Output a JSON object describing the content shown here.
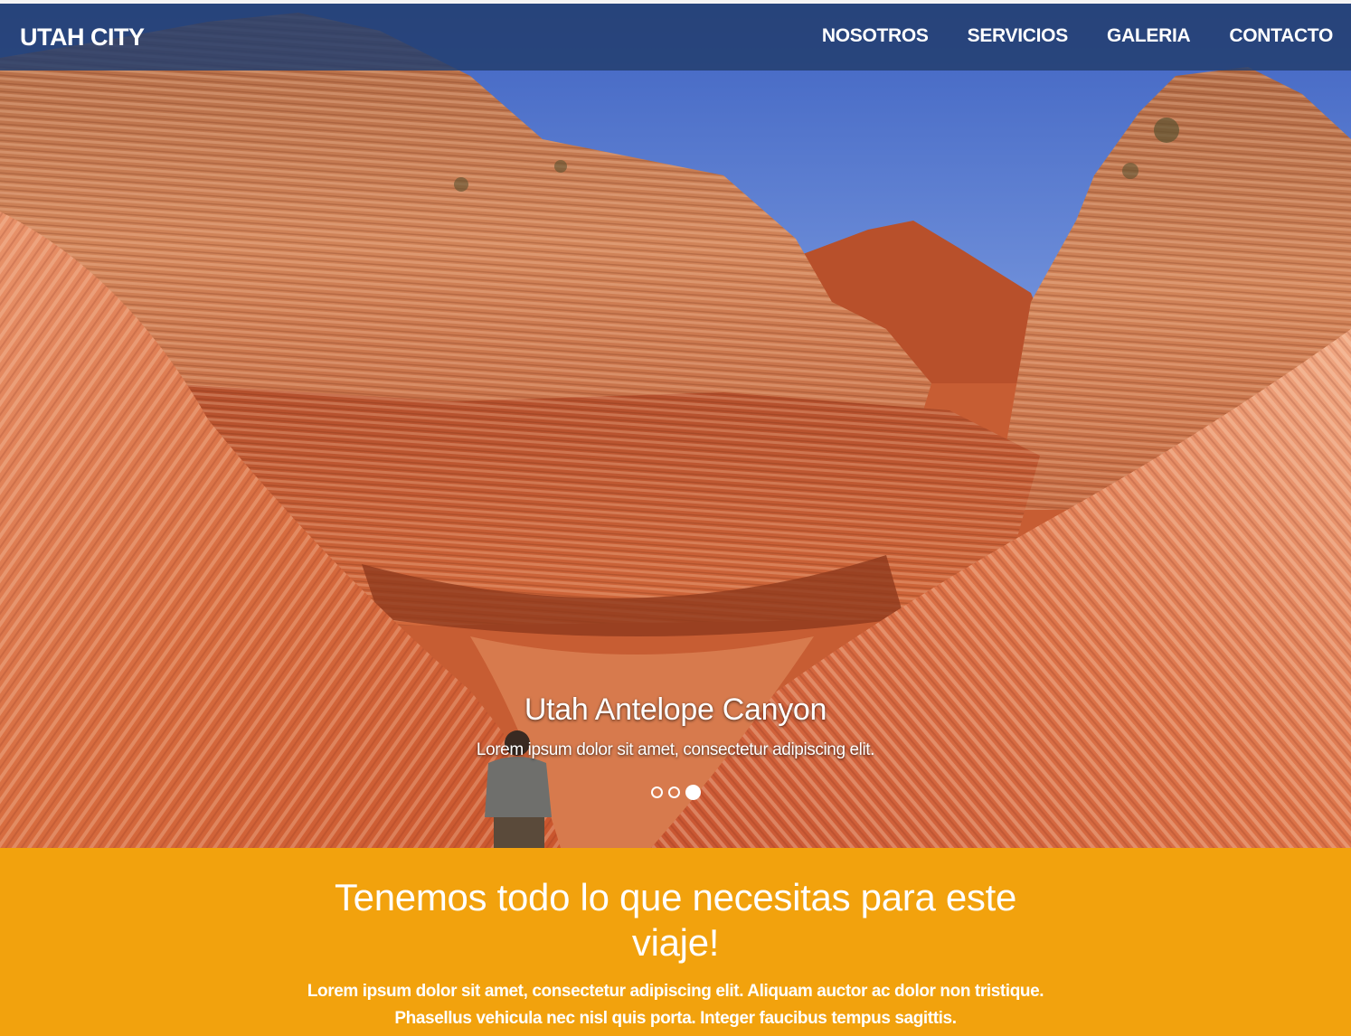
{
  "navbar": {
    "brand": "UTAH CITY",
    "links": [
      "NOSOTROS",
      "SERVICIOS",
      "GALERIA",
      "CONTACTO"
    ],
    "background": "#233e6e"
  },
  "carousel": {
    "caption_title": "Utah Antelope Canyon",
    "caption_text": "Lorem ipsum dolor sit amet, consectetur adipiscing elit.",
    "slides": 3,
    "active_slide": 3
  },
  "promo": {
    "heading": "Tenemos todo lo que necesitas para este viaje!",
    "text": "Lorem ipsum dolor sit amet, consectetur adipiscing elit. Aliquam auctor ac dolor non tristique. Phasellus vehicula nec nisl quis porta. Integer faucibus tempus sagittis.",
    "background": "#f2a20d"
  }
}
